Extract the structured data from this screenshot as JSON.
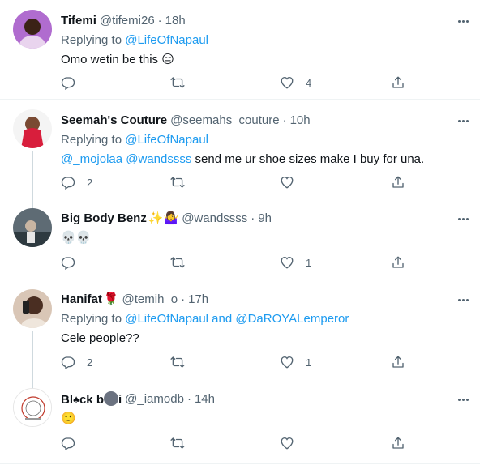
{
  "tweets": [
    {
      "name": "Tifemi",
      "name_emoji": "",
      "handle": "@tifemi26",
      "time": "18h",
      "replying_prefix": "Replying to ",
      "replying_to": "@LifeOfNapaul",
      "replying_and": "",
      "replying_to_2": "",
      "text": "Omo wetin be this 😑",
      "reply_count": "",
      "retweet_count": "",
      "like_count": "4"
    },
    {
      "name": "Seemah's Couture",
      "name_emoji": "",
      "handle": "@seemahs_couture",
      "time": "10h",
      "replying_prefix": "Replying to ",
      "replying_to": "@LifeOfNapaul",
      "mention_1": "@_mojolaa",
      "mention_2": "@wandssss",
      "text": " send me ur shoe sizes make I buy for una.",
      "reply_count": "2",
      "retweet_count": "",
      "like_count": ""
    },
    {
      "name": "Big Body Benz",
      "name_emoji": "✨🤷‍♀️",
      "handle": "@wandssss",
      "time": "9h",
      "text": "💀💀",
      "reply_count": "",
      "retweet_count": "",
      "like_count": "1"
    },
    {
      "name": "Hanifat",
      "name_emoji": "🌹",
      "handle": "@temih_o",
      "time": "17h",
      "replying_prefix": "Replying to ",
      "replying_to": "@LifeOfNapaul",
      "replying_and": " and ",
      "replying_to_2": "@DaROYALemperor",
      "text": "Cele people??",
      "reply_count": "2",
      "retweet_count": "",
      "like_count": "1"
    },
    {
      "name_part1": "Bl",
      "name_part2": "ck b",
      "name_part3": "i",
      "handle": "@_iamodb",
      "time": "14h",
      "text": "🙂",
      "reply_count": "",
      "retweet_count": "",
      "like_count": ""
    }
  ],
  "separator": "·",
  "colors": {
    "link": "#1d9bf0",
    "muted": "#536471",
    "text": "#0f1419",
    "divider": "#eff3f4"
  },
  "icons": [
    "reply-icon",
    "retweet-icon",
    "like-icon",
    "share-icon",
    "more-icon"
  ]
}
